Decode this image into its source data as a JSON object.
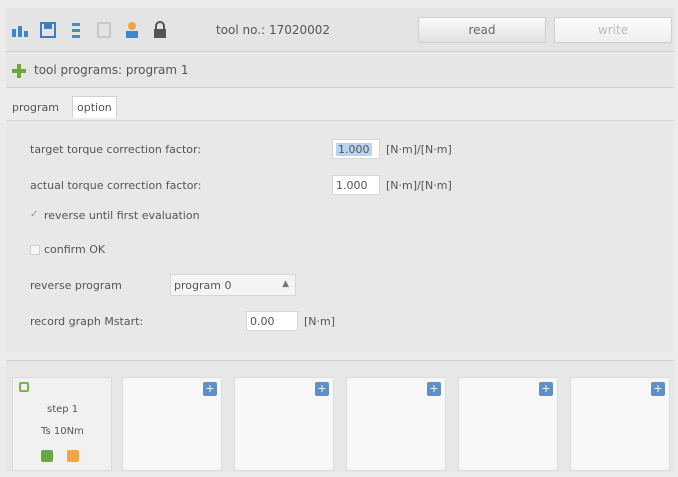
{
  "toolbar": {
    "tool_label": "tool no.: 17020002",
    "read_label": "read",
    "write_label": "write",
    "icons": [
      "stats-icon",
      "save-icon",
      "sort-icon",
      "page-icon",
      "profile-icon",
      "lock-icon"
    ]
  },
  "title": {
    "text": "tool programs: program 1"
  },
  "tabs": [
    {
      "label": "program"
    },
    {
      "label": "option"
    }
  ],
  "options": {
    "target_label": "target torque correction factor:",
    "target_value": "1.000",
    "target_unit": "[N·m]/[N·m]",
    "actual_label": "actual torque correction factor:",
    "actual_value": "1.000",
    "actual_unit": "[N·m]/[N·m]",
    "reverse_label": "reverse until first evaluation",
    "reverse_checked": true,
    "confirm_label": "confirm OK",
    "confirm_checked": false,
    "reverse_program_label": "reverse program",
    "reverse_program_value": "program 0",
    "record_label": "record graph Mstart:",
    "record_value": "0.00",
    "record_unit": "[N·m]"
  },
  "steps": [
    {
      "title": "step 1",
      "detail": "Ts 10Nm"
    },
    {
      "title": ""
    },
    {
      "title": ""
    },
    {
      "title": ""
    },
    {
      "title": ""
    },
    {
      "title": ""
    }
  ],
  "colors": {
    "accent_blue": "#5f8fc9",
    "green": "#6ba544",
    "orange": "#f2a544"
  }
}
